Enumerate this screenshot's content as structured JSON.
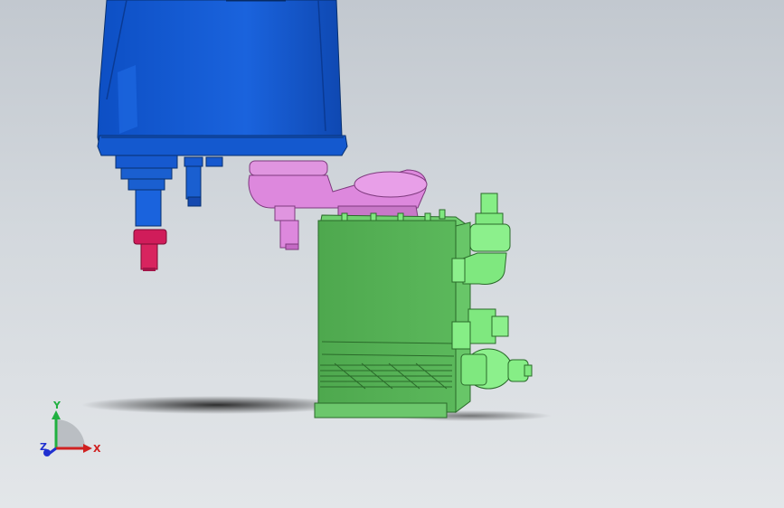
{
  "viewport": {
    "background_top": "#c2c8cf",
    "background_bottom": "#e3e6e9"
  },
  "model": {
    "parts": [
      "robot-base",
      "spindle",
      "robot-arm",
      "end-effector-block",
      "elbow-fitting",
      "valve-assembly"
    ],
    "colors": {
      "robot_base": "#1a5fd0",
      "spindle_tip": "#d01c5a",
      "arm": "#dd88dd",
      "block": "#5db35d",
      "fittings": "#7fe87f"
    }
  },
  "triad": {
    "x_label": "X",
    "y_label": "Y",
    "z_label": "Z",
    "x_color": "#d02020",
    "y_color": "#20b040",
    "z_color": "#2030d0"
  }
}
